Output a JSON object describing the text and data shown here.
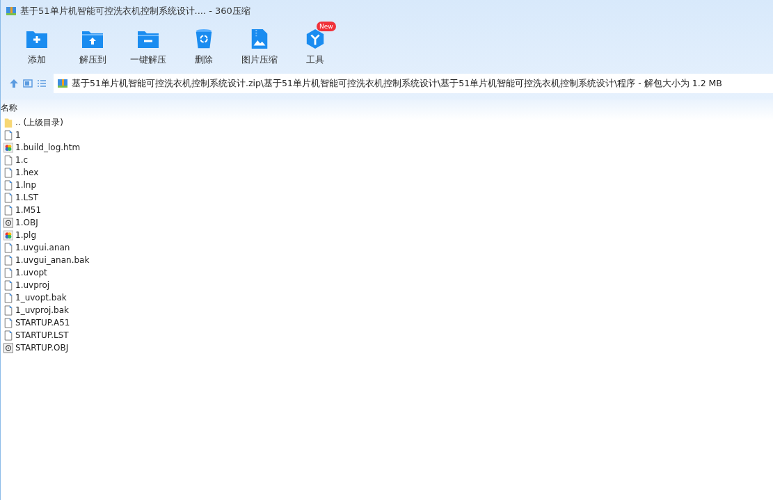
{
  "window": {
    "title": "基于51单片机智能可控洗衣机控制系统设计.... - 360压缩"
  },
  "toolbar": [
    {
      "label": "添加",
      "kind": "add"
    },
    {
      "label": "解压到",
      "kind": "extract"
    },
    {
      "label": "一键解压",
      "kind": "oneclick"
    },
    {
      "label": "删除",
      "kind": "delete"
    },
    {
      "label": "图片压缩",
      "kind": "image"
    },
    {
      "label": "工具",
      "kind": "tools",
      "badge": "New"
    }
  ],
  "address": {
    "path": "基于51单片机智能可控洗衣机控制系统设计.zip\\基于51单片机智能可控洗衣机控制系统设计\\基于51单片机智能可控洗衣机控制系统设计\\程序 - 解包大小为 1.2 MB"
  },
  "table": {
    "columns": [
      "名称"
    ],
    "rows": [
      {
        "name": ".. (上级目录)",
        "kind": "folder"
      },
      {
        "name": "1",
        "kind": "doc"
      },
      {
        "name": "1.build_log.htm",
        "kind": "web"
      },
      {
        "name": "1.c",
        "kind": "plain"
      },
      {
        "name": "1.hex",
        "kind": "doc"
      },
      {
        "name": "1.lnp",
        "kind": "doc"
      },
      {
        "name": "1.LST",
        "kind": "doc"
      },
      {
        "name": "1.M51",
        "kind": "doc"
      },
      {
        "name": "1.OBJ",
        "kind": "obj"
      },
      {
        "name": "1.plg",
        "kind": "web"
      },
      {
        "name": "1.uvgui.anan",
        "kind": "doc"
      },
      {
        "name": "1.uvgui_anan.bak",
        "kind": "doc"
      },
      {
        "name": "1.uvopt",
        "kind": "doc"
      },
      {
        "name": "1.uvproj",
        "kind": "doc"
      },
      {
        "name": "1_uvopt.bak",
        "kind": "doc"
      },
      {
        "name": "1_uvproj.bak",
        "kind": "doc"
      },
      {
        "name": "STARTUP.A51",
        "kind": "doc"
      },
      {
        "name": "STARTUP.LST",
        "kind": "doc"
      },
      {
        "name": "STARTUP.OBJ",
        "kind": "obj"
      }
    ]
  }
}
